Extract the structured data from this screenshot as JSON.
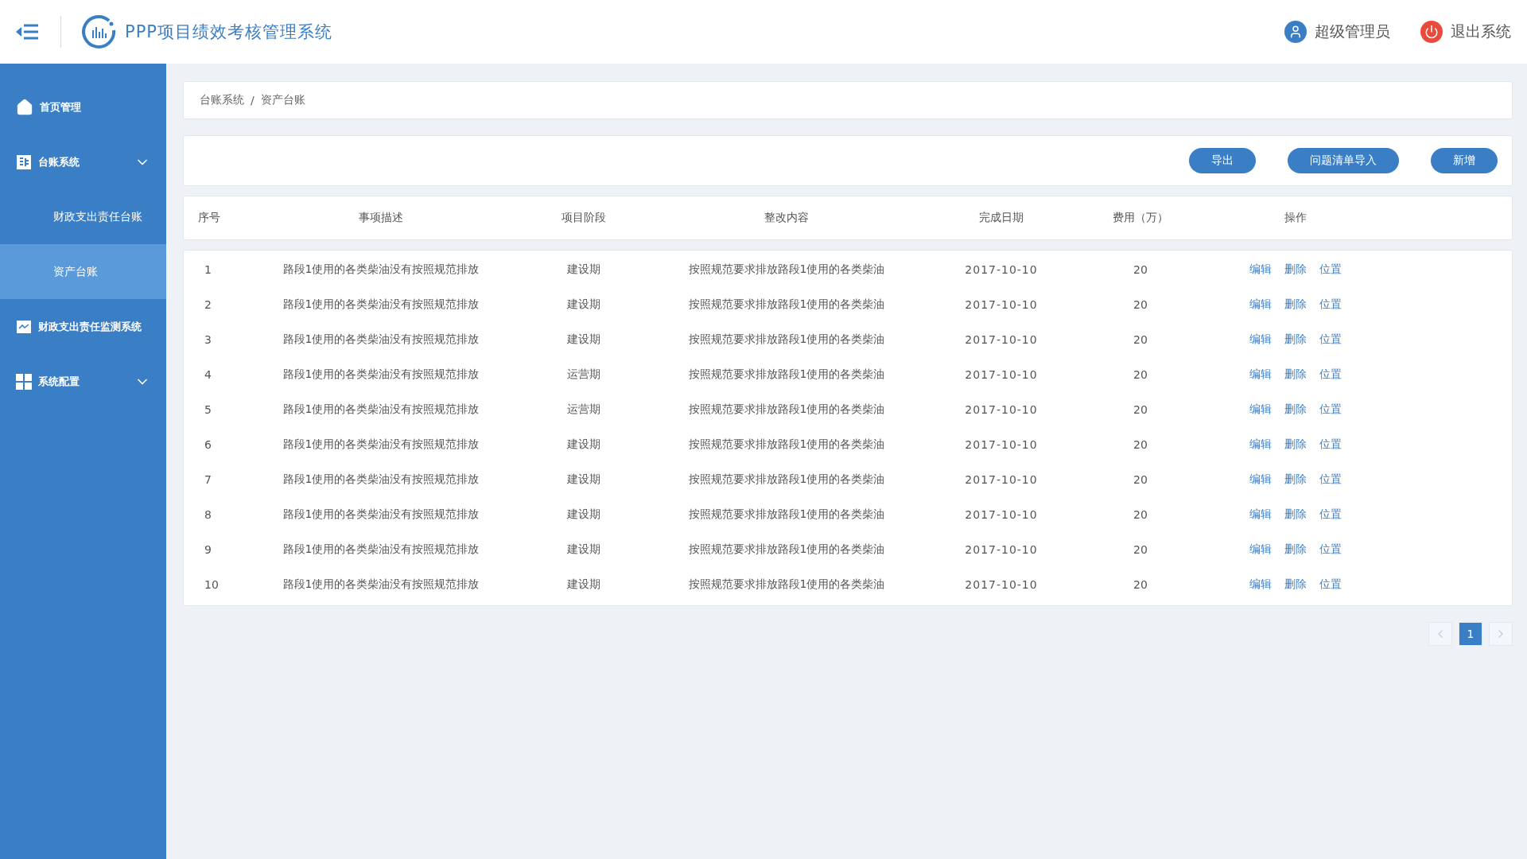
{
  "header": {
    "title": "PPP项目绩效考核管理系统",
    "user": "超级管理员",
    "logout": "退出系统"
  },
  "sidebar": {
    "items": [
      {
        "label": "首页管理",
        "kind": "link",
        "selected": false
      },
      {
        "label": "台账系统",
        "kind": "group",
        "selected": false,
        "children": [
          {
            "label": "财政支出责任台账",
            "selected": false
          },
          {
            "label": "资产台账",
            "selected": true
          }
        ]
      },
      {
        "label": "财政支出责任监测系统",
        "kind": "link",
        "selected": false
      },
      {
        "label": "系统配置",
        "kind": "group",
        "selected": false
      }
    ]
  },
  "breadcrumb": [
    "台账系统",
    "/",
    "资产台账"
  ],
  "toolbar": {
    "buttons": [
      "导出",
      "问题清单导入",
      "新增"
    ]
  },
  "table": {
    "columns": [
      "序号",
      "事项描述",
      "项目阶段",
      "整改内容",
      "完成日期",
      "费用（万）",
      "操作"
    ],
    "rows": [
      {
        "no": "1",
        "desc": "路段1使用的各类柴油没有按照规范排放",
        "stage": "建设期",
        "fix": "按照规范要求排放路段1使用的各类柴油",
        "date": "2017-10-10",
        "cost": "20",
        "actions": [
          "编辑",
          "删除",
          "位置"
        ]
      },
      {
        "no": "2",
        "desc": "路段1使用的各类柴油没有按照规范排放",
        "stage": "建设期",
        "fix": "按照规范要求排放路段1使用的各类柴油",
        "date": "2017-10-10",
        "cost": "20",
        "actions": [
          "编辑",
          "删除",
          "位置"
        ]
      },
      {
        "no": "3",
        "desc": "路段1使用的各类柴油没有按照规范排放",
        "stage": "建设期",
        "fix": "按照规范要求排放路段1使用的各类柴油",
        "date": "2017-10-10",
        "cost": "20",
        "actions": [
          "编辑",
          "删除",
          "位置"
        ]
      },
      {
        "no": "4",
        "desc": "路段1使用的各类柴油没有按照规范排放",
        "stage": "运营期",
        "fix": "按照规范要求排放路段1使用的各类柴油",
        "date": "2017-10-10",
        "cost": "20",
        "actions": [
          "编辑",
          "删除",
          "位置"
        ]
      },
      {
        "no": "5",
        "desc": "路段1使用的各类柴油没有按照规范排放",
        "stage": "运营期",
        "fix": "按照规范要求排放路段1使用的各类柴油",
        "date": "2017-10-10",
        "cost": "20",
        "actions": [
          "编辑",
          "删除",
          "位置"
        ]
      },
      {
        "no": "6",
        "desc": "路段1使用的各类柴油没有按照规范排放",
        "stage": "建设期",
        "fix": "按照规范要求排放路段1使用的各类柴油",
        "date": "2017-10-10",
        "cost": "20",
        "actions": [
          "编辑",
          "删除",
          "位置"
        ]
      },
      {
        "no": "7",
        "desc": "路段1使用的各类柴油没有按照规范排放",
        "stage": "建设期",
        "fix": "按照规范要求排放路段1使用的各类柴油",
        "date": "2017-10-10",
        "cost": "20",
        "actions": [
          "编辑",
          "删除",
          "位置"
        ]
      },
      {
        "no": "8",
        "desc": "路段1使用的各类柴油没有按照规范排放",
        "stage": "建设期",
        "fix": "按照规范要求排放路段1使用的各类柴油",
        "date": "2017-10-10",
        "cost": "20",
        "actions": [
          "编辑",
          "删除",
          "位置"
        ]
      },
      {
        "no": "9",
        "desc": "路段1使用的各类柴油没有按照规范排放",
        "stage": "建设期",
        "fix": "按照规范要求排放路段1使用的各类柴油",
        "date": "2017-10-10",
        "cost": "20",
        "actions": [
          "编辑",
          "删除",
          "位置"
        ]
      },
      {
        "no": "10",
        "desc": "路段1使用的各类柴油没有按照规范排放",
        "stage": "建设期",
        "fix": "按照规范要求排放路段1使用的各类柴油",
        "date": "2017-10-10",
        "cost": "20",
        "actions": [
          "编辑",
          "删除",
          "位置"
        ]
      }
    ]
  },
  "pagination": {
    "pages": [
      {
        "label": "1",
        "selected": true
      }
    ]
  }
}
